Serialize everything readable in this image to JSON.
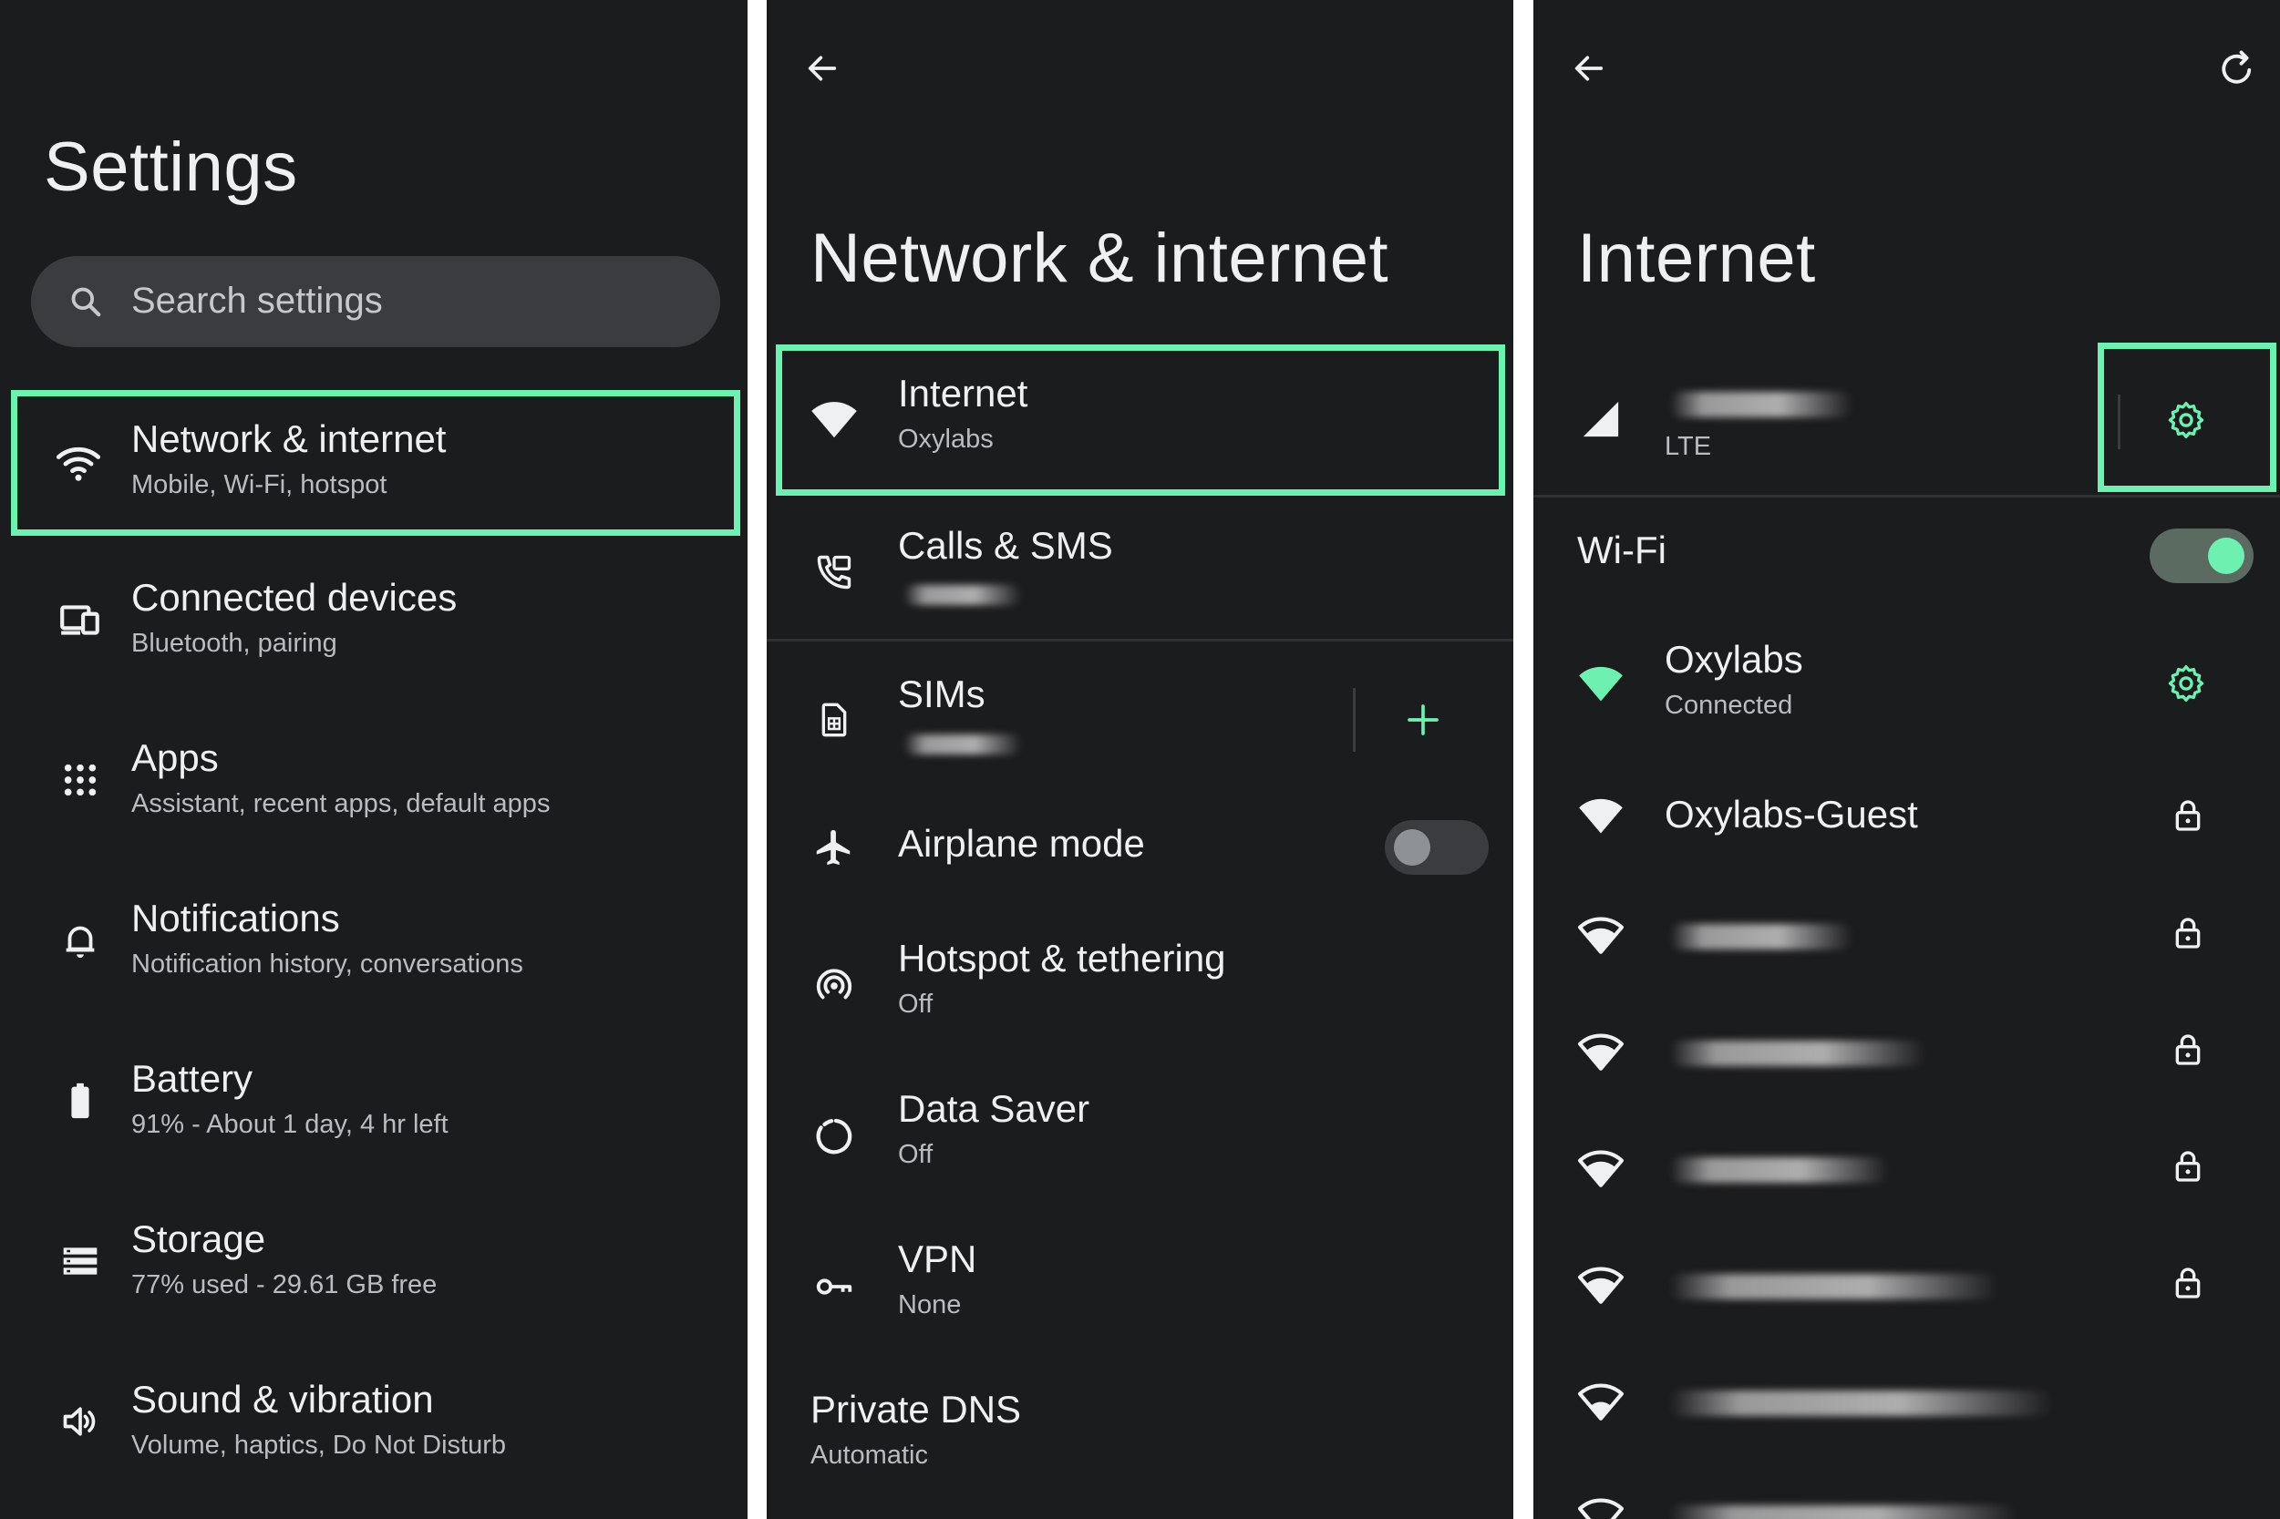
{
  "settings": {
    "title": "Settings",
    "search_placeholder": "Search settings",
    "items": [
      {
        "title": "Network & internet",
        "subtitle": "Mobile, Wi-Fi, hotspot",
        "icon": "wifi-icon"
      },
      {
        "title": "Connected devices",
        "subtitle": "Bluetooth, pairing",
        "icon": "devices-icon"
      },
      {
        "title": "Apps",
        "subtitle": "Assistant, recent apps, default apps",
        "icon": "apps-grid-icon"
      },
      {
        "title": "Notifications",
        "subtitle": "Notification history, conversations",
        "icon": "bell-icon"
      },
      {
        "title": "Battery",
        "subtitle": "91% - About 1 day, 4 hr left",
        "icon": "battery-icon"
      },
      {
        "title": "Storage",
        "subtitle": "77% used - 29.61 GB free",
        "icon": "storage-icon"
      },
      {
        "title": "Sound & vibration",
        "subtitle": "Volume, haptics, Do Not Disturb",
        "icon": "speaker-icon"
      }
    ]
  },
  "network": {
    "title": "Network & internet",
    "items": [
      {
        "title": "Internet",
        "subtitle": "Oxylabs"
      },
      {
        "title": "Calls & SMS",
        "subtitle": ""
      },
      {
        "title": "SIMs",
        "subtitle": ""
      },
      {
        "title": "Airplane mode",
        "toggle": false
      },
      {
        "title": "Hotspot & tethering",
        "subtitle": "Off"
      },
      {
        "title": "Data Saver",
        "subtitle": "Off"
      },
      {
        "title": "VPN",
        "subtitle": "None"
      },
      {
        "title": "Private DNS",
        "subtitle": "Automatic"
      }
    ]
  },
  "internet": {
    "title": "Internet",
    "mobile_sub": "LTE",
    "wifi_label": "Wi-Fi",
    "wifi_enabled": true,
    "networks": [
      {
        "name": "Oxylabs",
        "status": "Connected",
        "connected": true,
        "trailing": "gear-icon"
      },
      {
        "name": "Oxylabs-Guest",
        "status": "",
        "connected": false,
        "trailing": "lock-icon"
      }
    ]
  },
  "colors": {
    "background": "#1b1c1e",
    "accent": "#6ef0b0",
    "text": "#eef0f1",
    "subtext": "#b9bcc0"
  }
}
